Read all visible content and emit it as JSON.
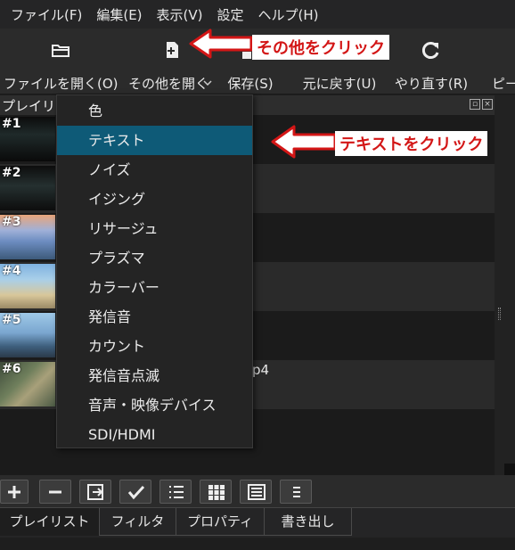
{
  "menu": [
    "ファイル(F)",
    "編集(E)",
    "表示(V)",
    "設定",
    "ヘルプ(H)"
  ],
  "toolbar": {
    "open_file": "ファイルを開く(O)",
    "open_other": "その他を開く",
    "save": "保存(S)",
    "undo": "元に戻す(U)",
    "redo": "やり直す(R)",
    "peak": "ピー"
  },
  "annotations": {
    "click_other": "その他をクリック",
    "click_text": "テキストをクリック",
    "color": "#d31616"
  },
  "playlist": {
    "title": "プレイリスト",
    "rows": [
      {
        "index": "#1",
        "text": ""
      },
      {
        "index": "#2",
        "text": ""
      },
      {
        "index": "#3",
        "text": ""
      },
      {
        "index": "#4",
        "text": ""
      },
      {
        "index": "#5",
        "text": ""
      },
      {
        "index": "#6",
        "text": "p4"
      }
    ]
  },
  "dropdown": {
    "items": [
      "色",
      "テキスト",
      "ノイズ",
      "イジング",
      "リサージュ",
      "プラズマ",
      "カラーバー",
      "発信音",
      "カウント",
      "発信音点滅",
      "音声・映像デバイス",
      "SDI/HDMI"
    ],
    "selected": "テキスト",
    "highlight": "#0e5a77"
  },
  "tabs": [
    "プレイリスト",
    "フィルタ",
    "プロパティ",
    "書き出し"
  ]
}
